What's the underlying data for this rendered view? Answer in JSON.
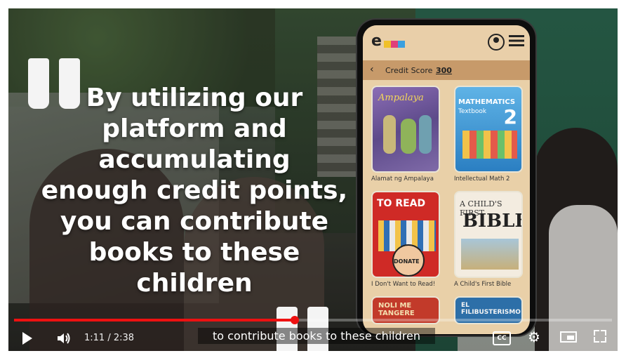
{
  "video": {
    "headline_lines": [
      "By utilizing our",
      "platform and",
      "accumulating",
      "enough credit points,",
      "you can contribute",
      "books to these",
      "children"
    ],
    "subtitle": "to contribute books to these children",
    "progress_fraction": 0.47
  },
  "phone_app": {
    "logo": "e",
    "credit_label": "Credit Score",
    "credit_value": "300",
    "books": [
      {
        "title_on_cover": "Ampalaya",
        "caption": "Alamat ng Ampalaya"
      },
      {
        "title_on_cover": "MATHEMATICS",
        "subtitle_on_cover": "Textbook",
        "number_on_cover": "2",
        "caption": "Intellectual Math 2"
      },
      {
        "title_on_cover": "TO READ",
        "badge": "DONATE",
        "caption": "I Don't Want to Read!"
      },
      {
        "title_on_cover": "A CHILD'S FIRST",
        "subtitle_on_cover": "BIBLE",
        "caption": "A Child's First Bible"
      },
      {
        "title_on_cover": "NOLI ME TANGERE",
        "caption": ""
      },
      {
        "title_on_cover": "EL FILIBUSTERISMO",
        "caption": ""
      }
    ]
  },
  "player": {
    "current_time": "1:11",
    "duration": "2:38",
    "time_sep": " / ",
    "cc_label": "CC"
  },
  "colors": {
    "progress": "#e11111",
    "app_bg": "#e9d0a8",
    "credit_bar": "#c79a6a"
  },
  "icons": {
    "play": "play-icon",
    "volume": "volume-icon",
    "settings": "gear-icon",
    "miniplayer": "miniplayer-icon",
    "fullscreen": "fullscreen-icon"
  }
}
